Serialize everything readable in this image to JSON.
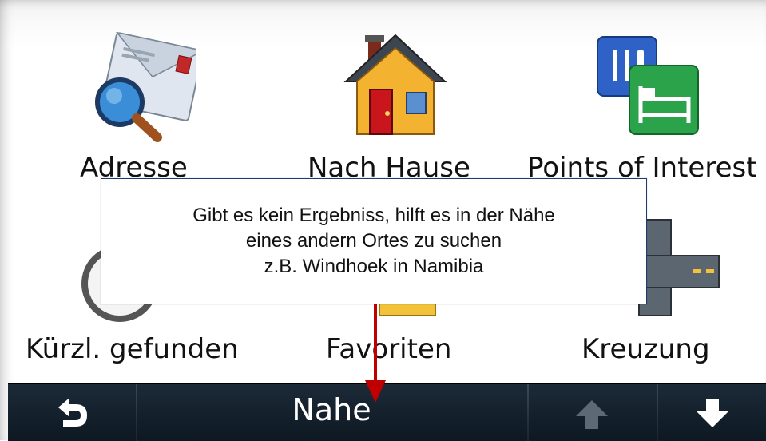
{
  "menu": {
    "items": [
      {
        "label": "Adresse",
        "icon": "address-search-icon"
      },
      {
        "label": "Nach Hause",
        "icon": "home-icon"
      },
      {
        "label": "Points of Interest",
        "icon": "points-of-interest-icon"
      },
      {
        "label": "Kürzl. gefunden",
        "icon": "recently-found-icon"
      },
      {
        "label": "Favoriten",
        "icon": "favorites-icon"
      },
      {
        "label": "Kreuzung",
        "icon": "intersection-icon"
      }
    ]
  },
  "bottom_bar": {
    "title": "Nahe",
    "back_icon": "back-icon",
    "up_icon": "arrow-up-icon",
    "down_icon": "arrow-down-icon"
  },
  "callout": {
    "lines": [
      "Gibt es kein Ergebniss, hilft es in der Nähe",
      "eines andern Ortes zu suchen",
      "z.B. Windhoek in Namibia"
    ],
    "arrow_color": "#c00000"
  },
  "colors": {
    "bar": "#0f1b27",
    "callout_border": "#1c3d6e"
  }
}
